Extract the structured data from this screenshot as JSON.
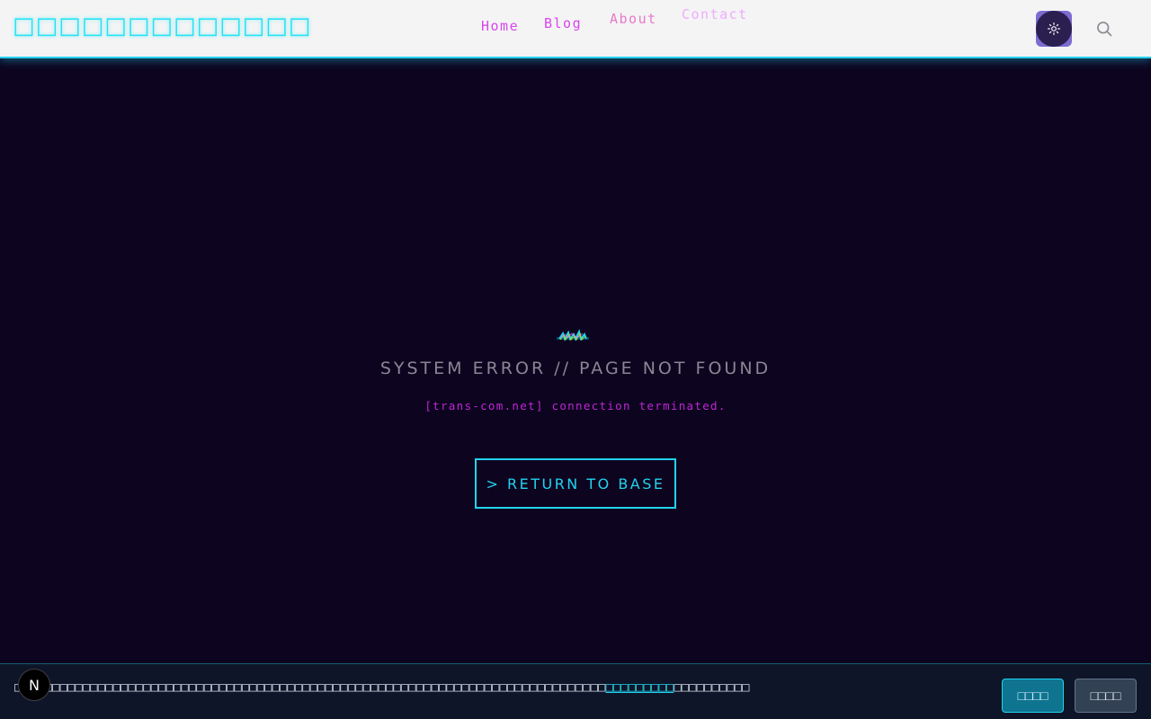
{
  "header": {
    "site_title": "□□□□□□□□□□□□□",
    "nav": [
      {
        "label": "Home"
      },
      {
        "label": "Blog"
      },
      {
        "label": "About"
      },
      {
        "label": "Contact"
      }
    ],
    "theme_toggle_icon": "sun-icon",
    "search_icon": "search-icon"
  },
  "main": {
    "glitch_icon": "glitch-icon",
    "error_title": "SYSTEM ERROR // PAGE NOT FOUND",
    "error_subtitle": "[trans-com.net] connection terminated.",
    "return_button": "> RETURN TO BASE"
  },
  "cookie_banner": {
    "text_before": "□□□□□□□□□□□□□□□□□□□□□□□□□□□□□□□□□□□□□□□□□□□□□□□□□□□□□□□□□□□□□□□□□□□□□□□□□□□□□□",
    "link_text": "□□□□□□□□□",
    "text_after": "□□□□□□□□□□",
    "accept_label": "□□□□",
    "decline_label": "□□□□"
  },
  "dev_badge": {
    "label": "N"
  },
  "colors": {
    "background": "#0d0420",
    "header_bg": "#f4f4f5",
    "accent_cyan": "#22d3ee",
    "accent_magenta": "#d946ef"
  }
}
